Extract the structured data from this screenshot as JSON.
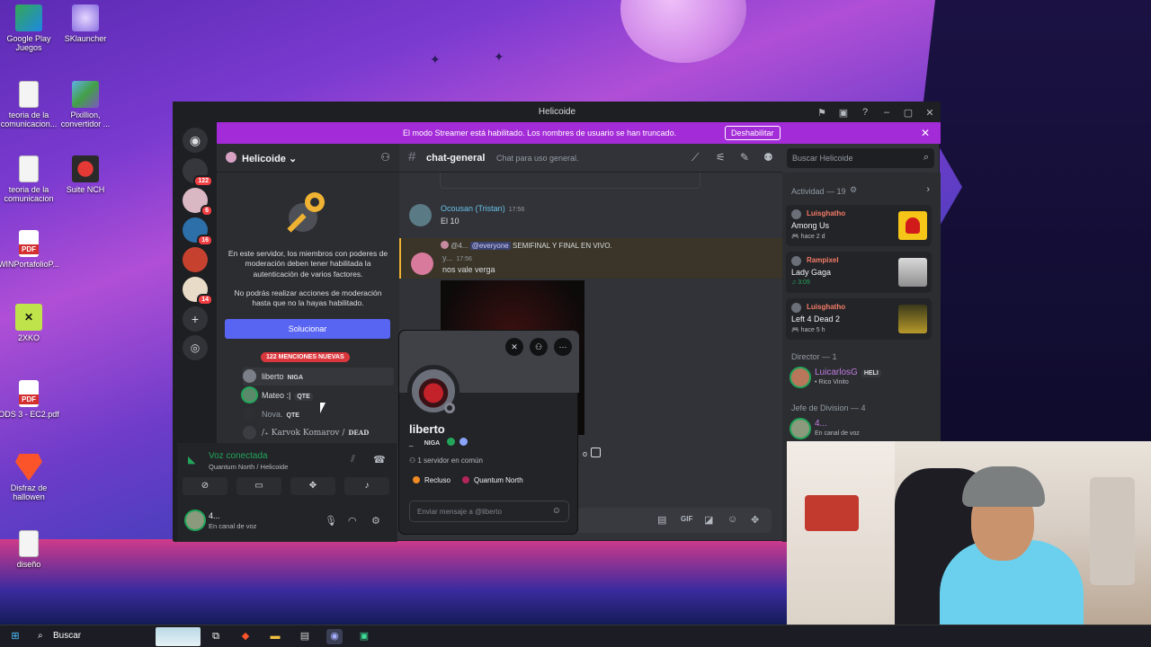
{
  "desktop": {
    "icons": [
      {
        "label": "Google Play Juegos"
      },
      {
        "label": "SKlauncher"
      },
      {
        "label": "teoria de la comunicacion..."
      },
      {
        "label": "Pixillion, convertidor ..."
      },
      {
        "label": "teoria de la comunicacion"
      },
      {
        "label": "Suite NCH"
      },
      {
        "label": "WINPortafolioP..."
      },
      {
        "label": "2XKO"
      },
      {
        "label": "ODS 3 - EC2.pdf"
      },
      {
        "label": "Disfraz de hallowen"
      },
      {
        "label": "diseño"
      }
    ]
  },
  "window": {
    "title": "Helicoide"
  },
  "banner": {
    "text": "El modo Streamer está habilitado. Los nombres de usuario se han truncado.",
    "button": "Deshabilitar",
    "close": "✕"
  },
  "guilds": {
    "badges": [
      "122",
      "6",
      "16",
      "14"
    ]
  },
  "server": {
    "name": "Helicoide ⌄",
    "mod_text_1": "En este servidor, los miembros con poderes de moderación deben tener habilitada la autenticación de varios factores.",
    "mod_text_2": "No podrás realizar acciones de moderación hasta que no la hayas habilitado.",
    "fix_button": "Solucionar",
    "mentions": "122 MENCIONES NUEVAS",
    "voice_users": [
      {
        "name": "liberto",
        "tag": "NIGA"
      },
      {
        "name": "Mateo :|",
        "tag": "QTE"
      },
      {
        "name": "Nova.",
        "tag": "QTE"
      },
      {
        "name": "﻿/₊ Karvok Komarov /",
        "tag": "DEAD"
      }
    ]
  },
  "voice_panel": {
    "status": "Voz conectada",
    "channel": "Quantum North / Helicoide",
    "user": "4...",
    "user_status": "En canal de voz"
  },
  "chat": {
    "channel": "chat-general",
    "topic": "Chat para uso general.",
    "messages": [
      {
        "author": "Ocousan (Tristan)",
        "time": "17:56",
        "text": "El 10"
      },
      {
        "reply_user": "@4...",
        "reply_mention": "@everyone",
        "reply_text": "SEMIFINAL Y FINAL EN VIVO.",
        "author": "y...",
        "time": "17:56",
        "text": "nos vale verga"
      }
    ],
    "trailing_text": "o"
  },
  "search": {
    "placeholder": "Buscar Helicoide"
  },
  "members": {
    "activity_header": "Actividad — 19",
    "activities": [
      {
        "user": "Luisghatho",
        "game": "Among Us",
        "time": "hace 2 d"
      },
      {
        "user": "Rampixel",
        "game": "Lady Gaga",
        "time": "3:09"
      },
      {
        "user": "Luisghatho",
        "game": "Left 4 Dead 2",
        "time": "hace 5 h"
      }
    ],
    "director_header": "Director — 1",
    "director": {
      "name": "LuicarlosG",
      "tag": "HELI",
      "status": "• Rico Vinito"
    },
    "jefe_header": "Jefe de Division — 4",
    "jefe": {
      "name": "4...",
      "status": "En canal de voz"
    }
  },
  "popout": {
    "name": "liberto",
    "handle": "_",
    "tag": "NIGA",
    "mutual": "1 servidor en común",
    "chips": [
      "Recluso",
      "Quantum North"
    ],
    "placeholder": "Enviar mensaje a @liberto"
  },
  "taskbar": {
    "search": "Buscar"
  },
  "colors": {
    "accent": "#5865f2",
    "streamer_banner": "#a42bd8",
    "online": "#23a55a",
    "mention_red": "#da373c"
  }
}
